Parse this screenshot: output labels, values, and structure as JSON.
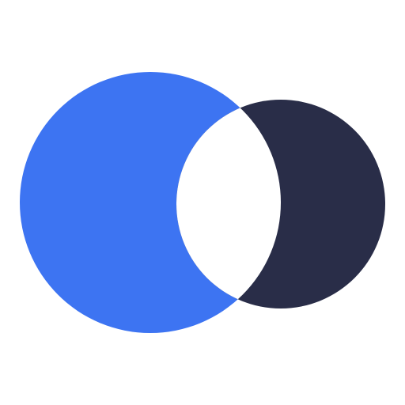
{
  "logo": {
    "name": "overlapping-circles-logo",
    "colors": {
      "background": "#ffffff",
      "left_circle": "#3d74f2",
      "right_circle": "#292d48",
      "overlap": "#ffffff"
    }
  }
}
